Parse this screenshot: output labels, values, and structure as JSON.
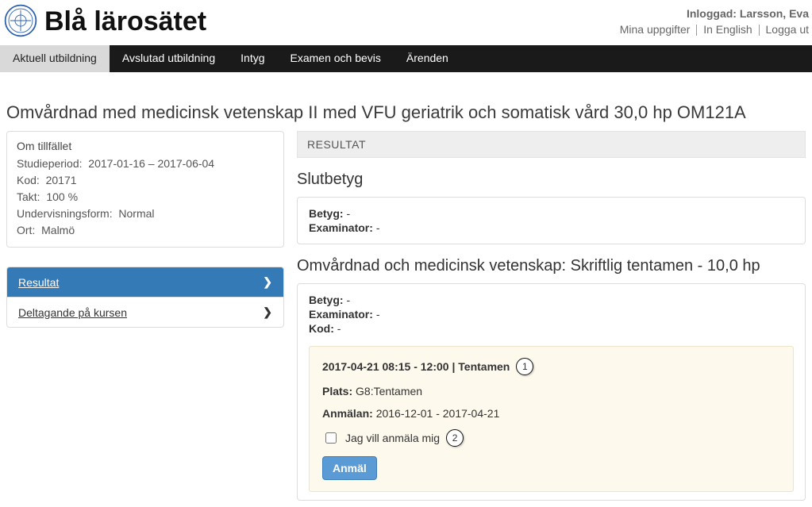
{
  "header": {
    "site_name": "Blå lärosätet",
    "logged_in_label": "Inloggad:",
    "user_name": "Larsson, Eva",
    "links": {
      "my_info": "Mina uppgifter",
      "english": "In English",
      "logout": "Logga ut"
    }
  },
  "nav": {
    "items": [
      {
        "label": "Aktuell utbildning",
        "active": true
      },
      {
        "label": "Avslutad utbildning",
        "active": false
      },
      {
        "label": "Intyg",
        "active": false
      },
      {
        "label": "Examen och bevis",
        "active": false
      },
      {
        "label": "Ärenden",
        "active": false
      }
    ]
  },
  "page_title": "Omvårdnad med medicinsk vetenskap II med VFU geriatrik och somatisk vård 30,0 hp OM121A",
  "about": {
    "title": "Om tillfället",
    "study_period_label": "Studieperiod:",
    "study_period_value": "2017-01-16 – 2017-06-04",
    "code_label": "Kod:",
    "code_value": "20171",
    "pace_label": "Takt:",
    "pace_value": "100 %",
    "form_label": "Undervisningsform:",
    "form_value": "Normal",
    "location_label": "Ort:",
    "location_value": "Malmö"
  },
  "sidenav": {
    "items": [
      {
        "label": "Resultat",
        "active": true
      },
      {
        "label": "Deltagande på kursen",
        "active": false
      }
    ]
  },
  "results": {
    "header": "RESULTAT",
    "final": {
      "heading": "Slutbetyg",
      "grade_label": "Betyg:",
      "grade_value": "-",
      "examiner_label": "Examinator:",
      "examiner_value": "-"
    },
    "module": {
      "heading": "Omvårdnad och medicinsk vetenskap: Skriftlig tentamen - 10,0 hp",
      "grade_label": "Betyg:",
      "grade_value": "-",
      "examiner_label": "Examinator:",
      "examiner_value": "-",
      "code_label": "Kod:",
      "code_value": "-",
      "exam": {
        "datetime": "2017-04-21 08:15 - 12:00",
        "type": "Tentamen",
        "place_label": "Plats:",
        "place_value": "G8:Tentamen",
        "reg_label": "Anmälan:",
        "reg_value": "2016-12-01 - 2017-04-21",
        "signup_text": "Jag vill anmäla mig",
        "button": "Anmäl"
      }
    }
  },
  "markers": {
    "m1": "1",
    "m2": "2"
  }
}
